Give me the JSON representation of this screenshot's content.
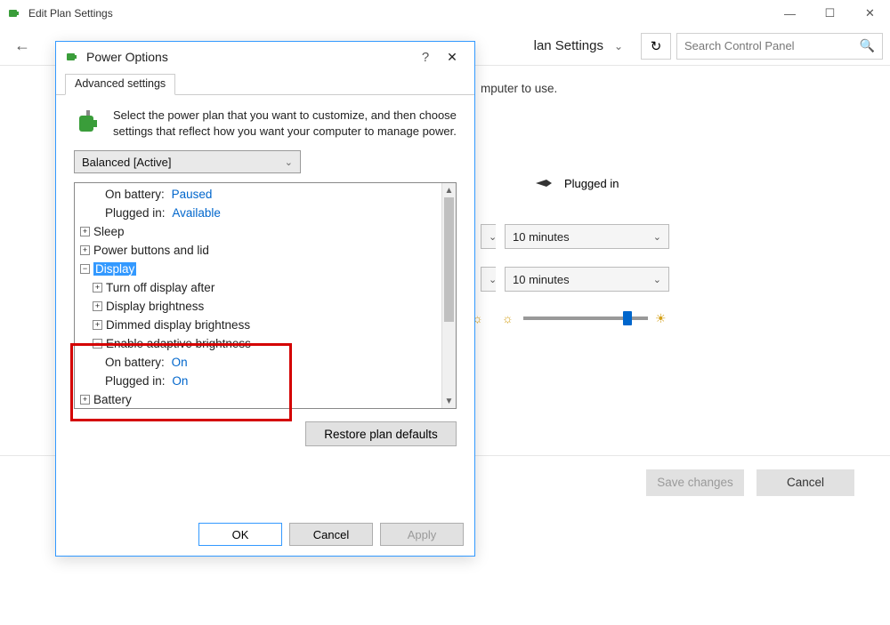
{
  "parent_window": {
    "title": "Edit Plan Settings",
    "breadcrumb_visible": "lan Settings",
    "search_placeholder": "Search Control Panel"
  },
  "bg": {
    "text_fragment": "mputer to use.",
    "plugged_in_label": "Plugged in",
    "dropdown1_value": "10 minutes",
    "dropdown2_value": "10 minutes",
    "save_button": "Save changes",
    "cancel_button": "Cancel"
  },
  "dialog": {
    "title": "Power Options",
    "tab_label": "Advanced settings",
    "description": "Select the power plan that you want to customize, and then choose settings that reflect how you want your computer to manage power.",
    "plan_selected": "Balanced [Active]",
    "tree": {
      "on_battery_label": "On battery:",
      "on_battery_value": "Paused",
      "plugged_in_label": "Plugged in:",
      "plugged_in_value": "Available",
      "sleep": "Sleep",
      "power_buttons": "Power buttons and lid",
      "display": "Display",
      "turn_off_display": "Turn off display after",
      "display_brightness": "Display brightness",
      "dimmed_brightness": "Dimmed display brightness",
      "adaptive_brightness": "Enable adaptive brightness",
      "ab_on_battery_label": "On battery:",
      "ab_on_battery_value": "On",
      "ab_plugged_in_label": "Plugged in:",
      "ab_plugged_in_value": "On",
      "battery": "Battery"
    },
    "restore_button": "Restore plan defaults",
    "ok_button": "OK",
    "cancel_button": "Cancel",
    "apply_button": "Apply"
  }
}
